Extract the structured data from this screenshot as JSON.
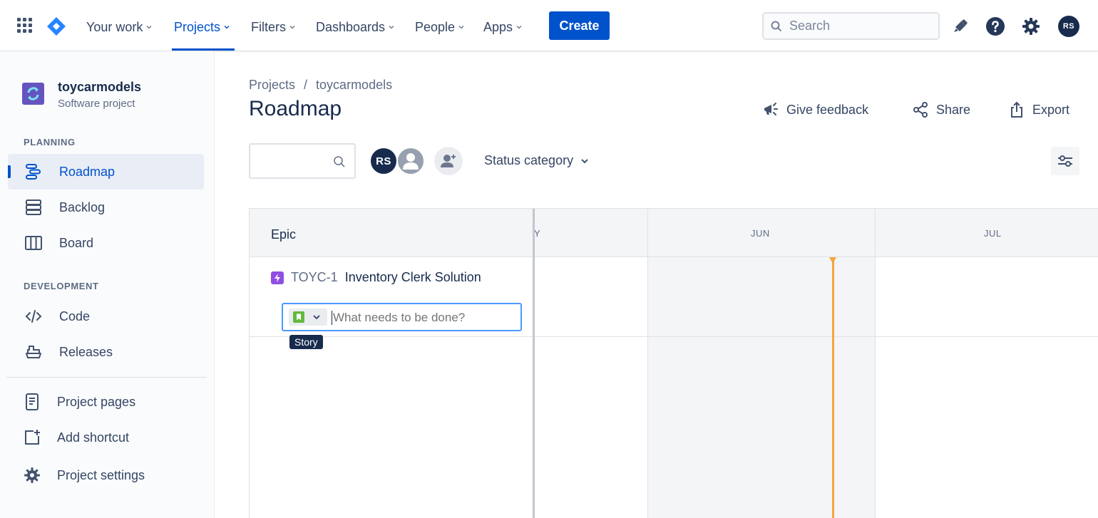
{
  "topnav": {
    "items": [
      {
        "label": "Your work"
      },
      {
        "label": "Projects"
      },
      {
        "label": "Filters"
      },
      {
        "label": "Dashboards"
      },
      {
        "label": "People"
      },
      {
        "label": "Apps"
      }
    ],
    "create_label": "Create",
    "search_placeholder": "Search",
    "avatar_initials": "RS"
  },
  "sidebar": {
    "project_name": "toycarmodels",
    "project_type": "Software project",
    "planning_label": "PLANNING",
    "development_label": "DEVELOPMENT",
    "planning_items": [
      {
        "label": "Roadmap",
        "icon": "roadmap-icon"
      },
      {
        "label": "Backlog",
        "icon": "backlog-icon"
      },
      {
        "label": "Board",
        "icon": "board-icon"
      }
    ],
    "development_items": [
      {
        "label": "Code",
        "icon": "code-icon"
      },
      {
        "label": "Releases",
        "icon": "releases-icon"
      }
    ],
    "bottom_items": [
      {
        "label": "Project pages",
        "icon": "project-pages-icon"
      },
      {
        "label": "Add shortcut",
        "icon": "add-shortcut-icon"
      },
      {
        "label": "Project settings",
        "icon": "gear-icon"
      }
    ]
  },
  "main": {
    "breadcrumb": [
      "Projects",
      "/",
      "toycarmodels"
    ],
    "title": "Roadmap",
    "actions": {
      "feedback": "Give feedback",
      "share": "Share",
      "export": "Export"
    },
    "avatar_initials": "RS",
    "status_filter": "Status category"
  },
  "roadmap": {
    "epic_header": "Epic",
    "months": [
      "Y",
      "JUN",
      "JUL"
    ],
    "epic": {
      "key": "TOYC-1",
      "name": "Inventory Clerk Solution"
    },
    "create_placeholder": "What needs to be done?",
    "tooltip": "Story"
  },
  "colors": {
    "primary": "#0052CC",
    "text": "#172B4D",
    "today_marker": "#F6A53B",
    "epic_purple": "#904EE2",
    "story_green": "#63BA3C"
  }
}
